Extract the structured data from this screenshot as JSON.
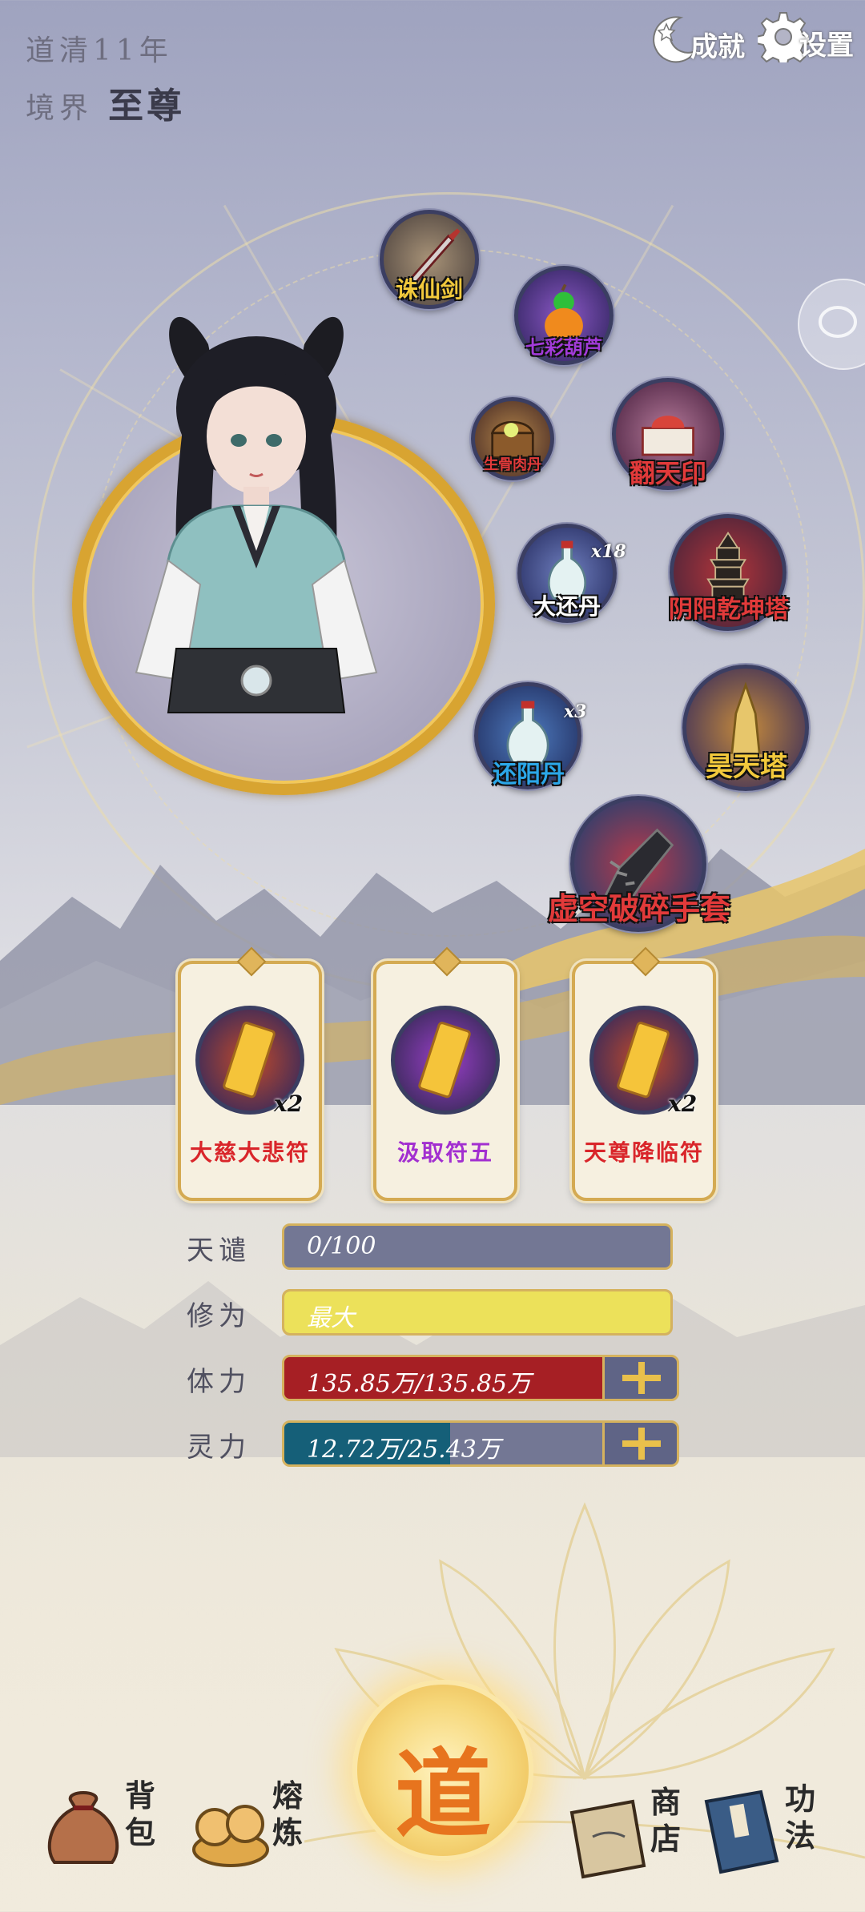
{
  "header": {
    "era": "道清11年",
    "realm_label": "境界",
    "realm_value": "至尊",
    "achievements_label": "成就",
    "settings_label": "设置"
  },
  "items": [
    {
      "name": "诛仙剑",
      "color": "#f2c93c"
    },
    {
      "name": "七彩葫芦",
      "color": "#a23bd9"
    },
    {
      "name": "生骨肉丹",
      "color": "#e23a3a"
    },
    {
      "name": "翻天印",
      "color": "#e23a3a"
    },
    {
      "name": "大还丹",
      "count": "x18",
      "color": "#ffffff"
    },
    {
      "name": "阴阳乾坤塔",
      "color": "#e23a3a"
    },
    {
      "name": "还阳丹",
      "count": "x3",
      "color": "#2ba7e8"
    },
    {
      "name": "昊天塔",
      "color": "#f2c93c"
    },
    {
      "name": "虚空破碎手套",
      "color": "#e23a3a"
    }
  ],
  "talismans": [
    {
      "name": "大慈大悲符",
      "count": "x2",
      "color": "#d9252a"
    },
    {
      "name": "汲取符五",
      "count": "",
      "color": "#a22fd0"
    },
    {
      "name": "天尊降临符",
      "count": "x2",
      "color": "#d9252a"
    }
  ],
  "stats": {
    "tribulation": {
      "label": "天谴",
      "value": "0/100",
      "fill_fraction": 0.0
    },
    "cultivation": {
      "label": "修为",
      "value": "最大",
      "fill_fraction": 1.0
    },
    "stamina": {
      "label": "体力",
      "value": "135.85万/135.85万",
      "fill_fraction": 1.0
    },
    "spirit": {
      "label": "灵力",
      "value": "12.72万/25.43万",
      "fill_fraction": 0.5
    }
  },
  "nav": {
    "bag": "背包",
    "refine": "熔炼",
    "dao": "道",
    "shop": "商店",
    "skills": "功法"
  }
}
